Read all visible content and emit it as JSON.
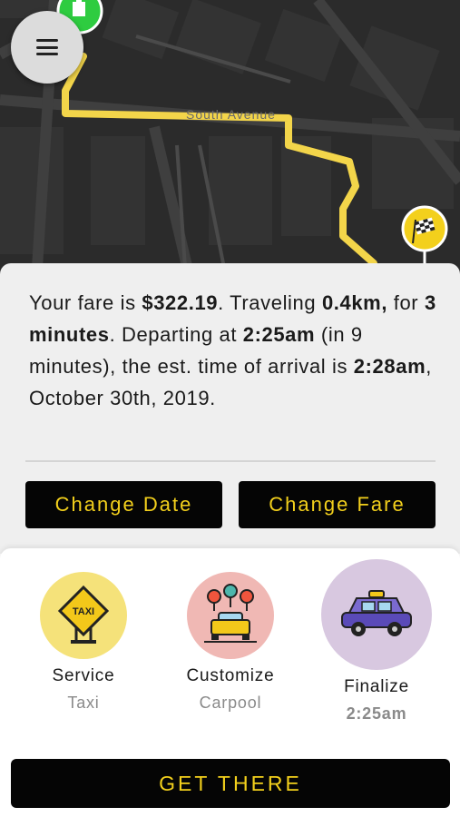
{
  "map": {
    "street_label": "South Avenue"
  },
  "fare": {
    "t1": "Your fare is ",
    "price": "$322.19",
    "t2": ". Traveling ",
    "distance": "0.4km,",
    "t3": " for ",
    "duration": "3 minutes",
    "t4": ". Departing at ",
    "depart": "2:25am",
    "t5": " (in 9 minutes), the est. time of arrival is ",
    "arrive": "2:28am",
    "t6": ", October 30th, 2019."
  },
  "buttons": {
    "change_date": "Change Date",
    "change_fare": "Change Fare",
    "get_there": "GET THERE"
  },
  "steps": [
    {
      "title": "Service",
      "subtitle": "Taxi",
      "icon": "taxi-sign-icon",
      "circle_color": "#f5e27a"
    },
    {
      "title": "Customize",
      "subtitle": "Carpool",
      "icon": "carpool-icon",
      "circle_color": "#f0b8b4"
    },
    {
      "title": "Finalize",
      "subtitle": "2:25am",
      "icon": "car-icon",
      "circle_color": "#d8c8e0"
    }
  ],
  "colors": {
    "accent": "#f3d01c",
    "route": "#f3d54a",
    "map_bg": "#2b2b2b",
    "start_marker": "#2ecc40"
  }
}
